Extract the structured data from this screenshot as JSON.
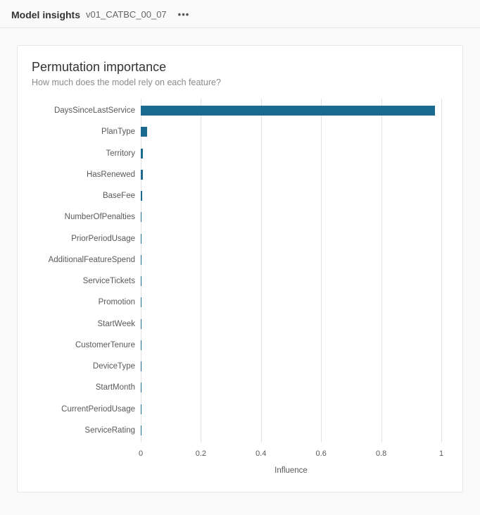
{
  "header": {
    "title": "Model insights",
    "subtitle": "v01_CATBC_00_07",
    "more_icon_label": "..."
  },
  "card": {
    "title": "Permutation importance",
    "subtitle": "How much does the model rely on each feature?"
  },
  "chart_data": {
    "type": "bar",
    "orientation": "horizontal",
    "title": "Permutation importance",
    "xlabel": "Influence",
    "ylabel": "",
    "xlim": [
      0,
      1
    ],
    "ticks": [
      0,
      0.2,
      0.4,
      0.6,
      0.8,
      1
    ],
    "categories": [
      "DaysSinceLastService",
      "PlanType",
      "Territory",
      "HasRenewed",
      "BaseFee",
      "NumberOfPenalties",
      "PriorPeriodUsage",
      "AdditionalFeatureSpend",
      "ServiceTickets",
      "Promotion",
      "StartWeek",
      "CustomerTenure",
      "DeviceType",
      "StartMonth",
      "CurrentPeriodUsage",
      "ServiceRating"
    ],
    "values": [
      0.98,
      0.02,
      0.008,
      0.007,
      0.005,
      0.002,
      0.002,
      0.001,
      0.001,
      0.001,
      0.001,
      0.0005,
      0.0005,
      0.0005,
      0.0003,
      0.0003
    ],
    "bar_color": "#1b6a8f"
  }
}
